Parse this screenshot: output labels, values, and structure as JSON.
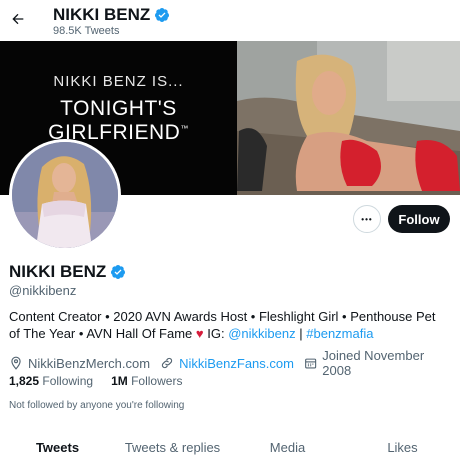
{
  "header": {
    "title": "NIKKI BENZ",
    "tweet_count": "98.5K Tweets",
    "back_icon": "arrow-left-icon"
  },
  "banner": {
    "line1": "NIKKI BENZ IS...",
    "line2": "TONIGHT'S GIRLFRIEND",
    "trademark": "™"
  },
  "actions": {
    "more_label": "•••",
    "follow_label": "Follow"
  },
  "profile": {
    "name": "NIKKI BENZ",
    "handle": "@nikkibenz",
    "verified_color": "#1d9bf0",
    "bio_text": "Content Creator • 2020 AVN Awards Host • Fleshlight Girl • Penthouse Pet of The Year •  AVN Hall Of Fame",
    "bio_heart": "♥",
    "bio_ig_label": "IG:",
    "bio_ig_link": "@nikkibenz",
    "bio_separator": "|",
    "bio_hashtag": "#benzmafia",
    "location": "NikkiBenzMerch.com",
    "website": "NikkiBenzFans.com",
    "joined": "Joined November 2008",
    "following_count": "1,825",
    "following_label": "Following",
    "followers_count": "1M",
    "followers_label": "Followers",
    "followed_by_note": "Not followed by anyone you're following"
  },
  "tabs": [
    {
      "label": "Tweets",
      "active": true
    },
    {
      "label": "Tweets & replies",
      "active": false
    },
    {
      "label": "Media",
      "active": false
    },
    {
      "label": "Likes",
      "active": false
    }
  ],
  "colors": {
    "accent": "#1d9bf0",
    "text": "#0f1419",
    "secondary": "#536471"
  }
}
